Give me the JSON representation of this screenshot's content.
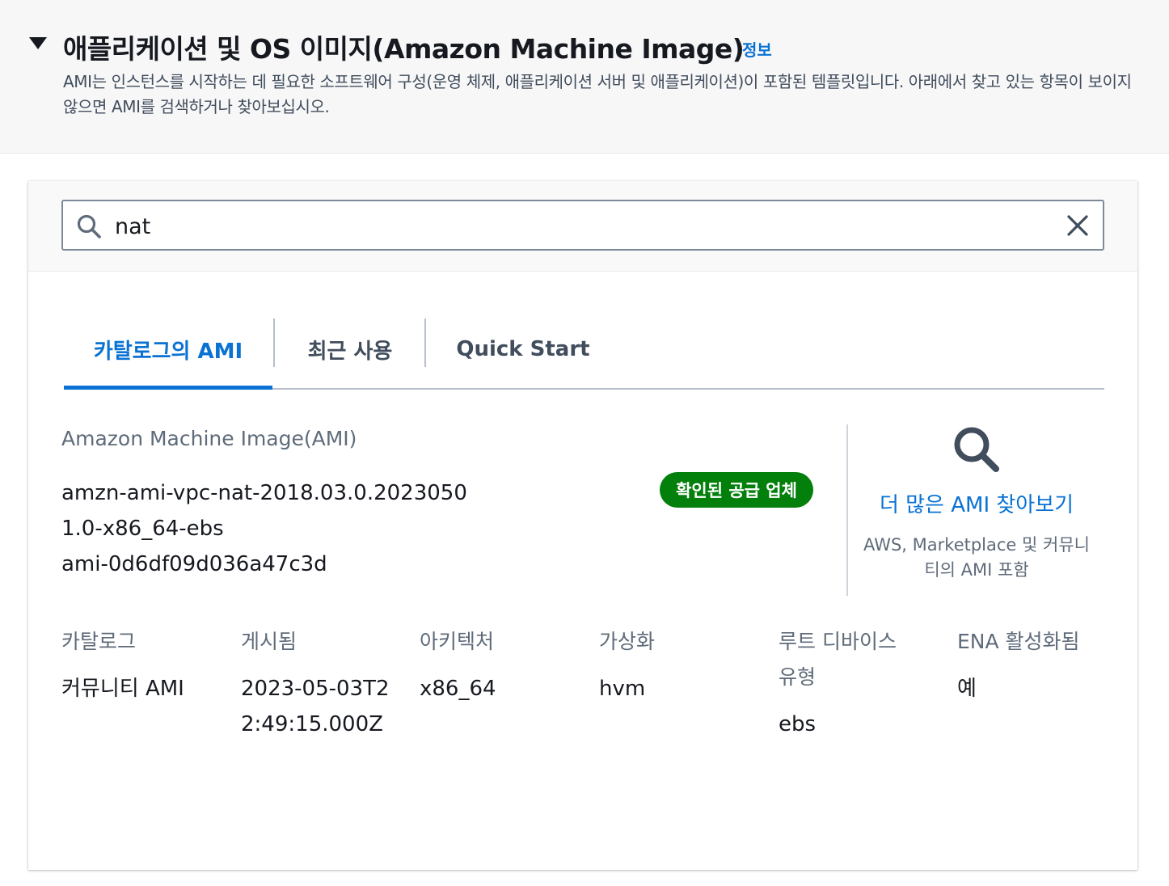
{
  "section": {
    "title": "애플리케이션 및 OS 이미지(Amazon Machine Image)",
    "info_link": "정보",
    "description": "AMI는 인스턴스를 시작하는 데 필요한 소프트웨어 구성(운영 체제, 애플리케이션 서버 및 애플리케이션)이 포함된 템플릿입니다. 아래에서 찾고 있는 항목이 보이지 않으면 AMI를 검색하거나 찾아보십시오."
  },
  "search": {
    "value": "nat",
    "icon": "search-icon",
    "clear_icon": "close-icon"
  },
  "tabs": [
    {
      "label": "카탈로그의 AMI",
      "active": true
    },
    {
      "label": "최근 사용",
      "active": false
    },
    {
      "label": "Quick Start",
      "active": false
    }
  ],
  "ami": {
    "label": "Amazon Machine Image(AMI)",
    "name": "amzn-ami-vpc-nat-2018.03.0.20230501.0-x86_64-ebs",
    "id": "ami-0d6df09d036a47c3d",
    "badge": "확인된 공급 업체"
  },
  "find_more": {
    "link": "더 많은 AMI 찾아보기",
    "subtitle": "AWS, Marketplace 및 커뮤니티의 AMI 포함"
  },
  "details": [
    {
      "label": "카탈로그",
      "value": "커뮤니티 AMI"
    },
    {
      "label": "게시됨",
      "value": "2023-05-03T22:49:15.000Z"
    },
    {
      "label": "아키텍처",
      "value": "x86_64"
    },
    {
      "label": "가상화",
      "value": "hvm"
    },
    {
      "label": "루트 디바이스 유형",
      "value": "ebs"
    },
    {
      "label": "ENA 활성화됨",
      "value": "예"
    }
  ],
  "colors": {
    "accent": "#0972d3",
    "badge_bg": "#037f0c",
    "text": "#16191f",
    "muted": "#5f6b7a"
  }
}
